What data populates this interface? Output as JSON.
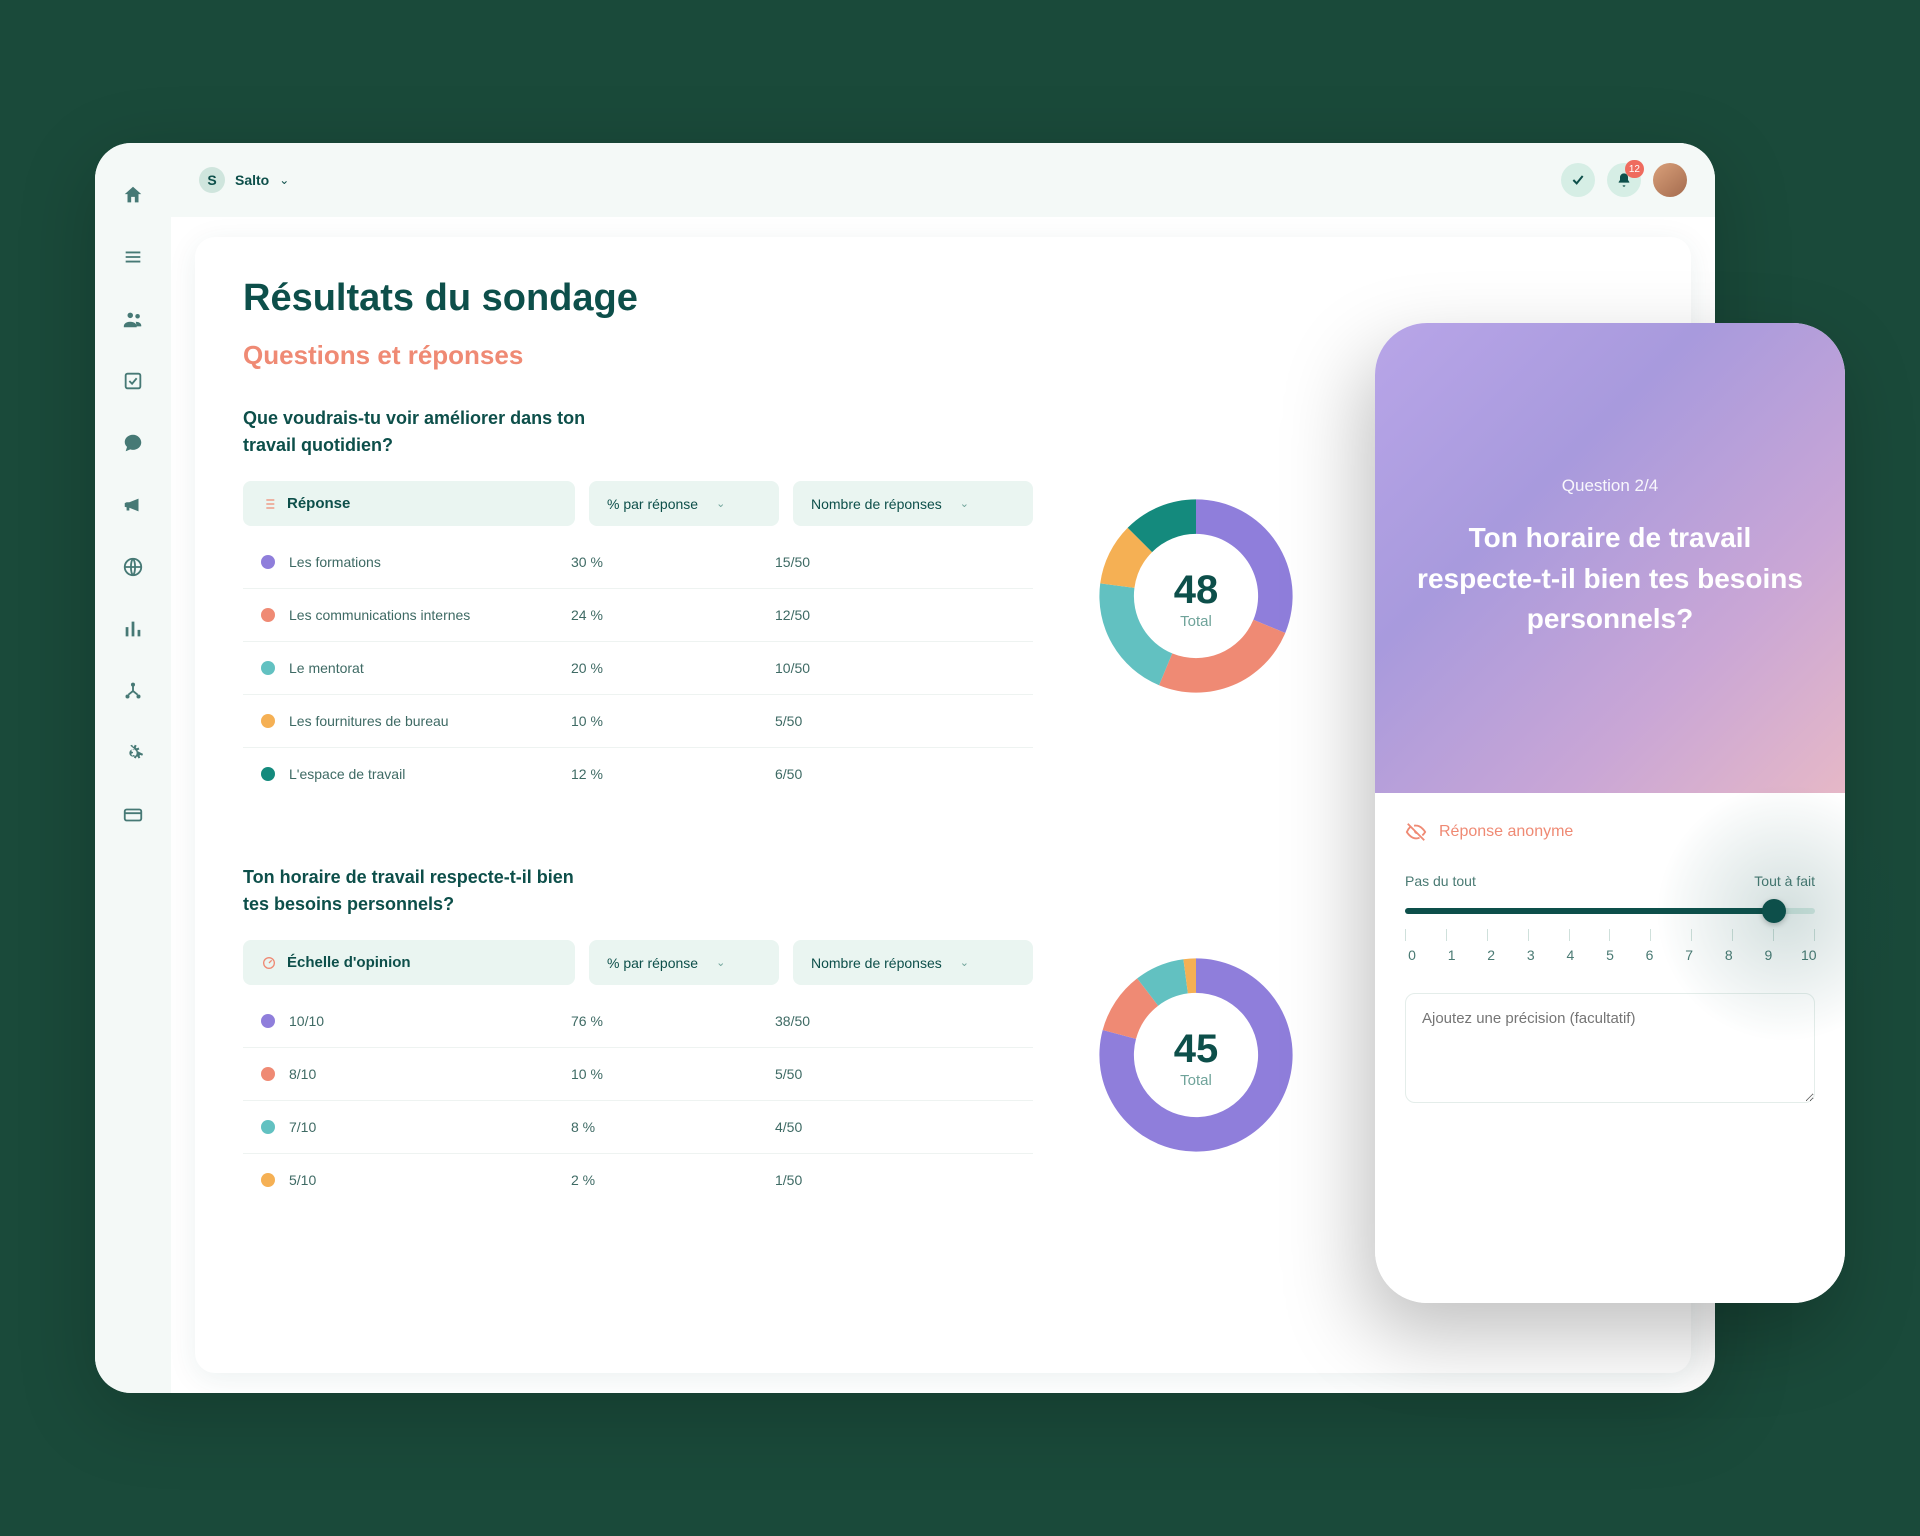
{
  "org": {
    "badge": "S",
    "name": "Salto"
  },
  "notifications": {
    "count": "12"
  },
  "page": {
    "title": "Résultats du sondage",
    "section": "Questions et réponses"
  },
  "common": {
    "totalLabel": "Total"
  },
  "colors": {
    "purple": "#8f7edb",
    "coral": "#ef8a74",
    "teal": "#62c1c1",
    "orange": "#f5b054",
    "deepTeal": "#148a7d"
  },
  "q1": {
    "text": "Que voudrais-tu voir améliorer dans ton travail quotidien?",
    "headLabel": "Réponse",
    "headPct": "% par réponse",
    "headCount": "Nombre de réponses",
    "total": "48",
    "rows": [
      {
        "label": "Les formations",
        "pct": "30 %",
        "count": "15/50",
        "colorKey": "purple"
      },
      {
        "label": "Les communications internes",
        "pct": "24 %",
        "count": "12/50",
        "colorKey": "coral"
      },
      {
        "label": "Le mentorat",
        "pct": "20 %",
        "count": "10/50",
        "colorKey": "teal"
      },
      {
        "label": "Les fournitures de bureau",
        "pct": "10 %",
        "count": "5/50",
        "colorKey": "orange"
      },
      {
        "label": "L'espace de travail",
        "pct": "12 %",
        "count": "6/50",
        "colorKey": "deepTeal"
      }
    ]
  },
  "q2": {
    "text": "Ton horaire de travail respecte-t-il bien tes besoins personnels?",
    "headLabel": "Échelle d'opinion",
    "headPct": "% par réponse",
    "headCount": "Nombre de réponses",
    "total": "45",
    "rows": [
      {
        "label": "10/10",
        "pct": "76 %",
        "count": "38/50",
        "colorKey": "purple"
      },
      {
        "label": "8/10",
        "pct": "10 %",
        "count": "5/50",
        "colorKey": "coral"
      },
      {
        "label": "7/10",
        "pct": "8 %",
        "count": "4/50",
        "colorKey": "teal"
      },
      {
        "label": "5/10",
        "pct": "2 %",
        "count": "1/50",
        "colorKey": "orange"
      }
    ]
  },
  "phone": {
    "counter": "Question 2/4",
    "question": "Ton horaire de travail respecte-t-il bien tes besoins personnels?",
    "anon": "Réponse anonyme",
    "sliderMinLabel": "Pas du tout",
    "sliderMaxLabel": "Tout à fait",
    "sliderValue": 9,
    "sliderMax": 10,
    "notePlaceholder": "Ajoutez une précision (facultatif)"
  },
  "chart_data": [
    {
      "type": "pie",
      "title": "Que voudrais-tu voir améliorer dans ton travail quotidien?",
      "categories": [
        "Les formations",
        "Les communications internes",
        "Le mentorat",
        "Les fournitures de bureau",
        "L'espace de travail"
      ],
      "values": [
        30,
        24,
        20,
        10,
        12
      ],
      "total_responses": 48
    },
    {
      "type": "pie",
      "title": "Ton horaire de travail respecte-t-il bien tes besoins personnels?",
      "categories": [
        "10/10",
        "8/10",
        "7/10",
        "5/10"
      ],
      "values": [
        76,
        10,
        8,
        2
      ],
      "total_responses": 45
    }
  ]
}
